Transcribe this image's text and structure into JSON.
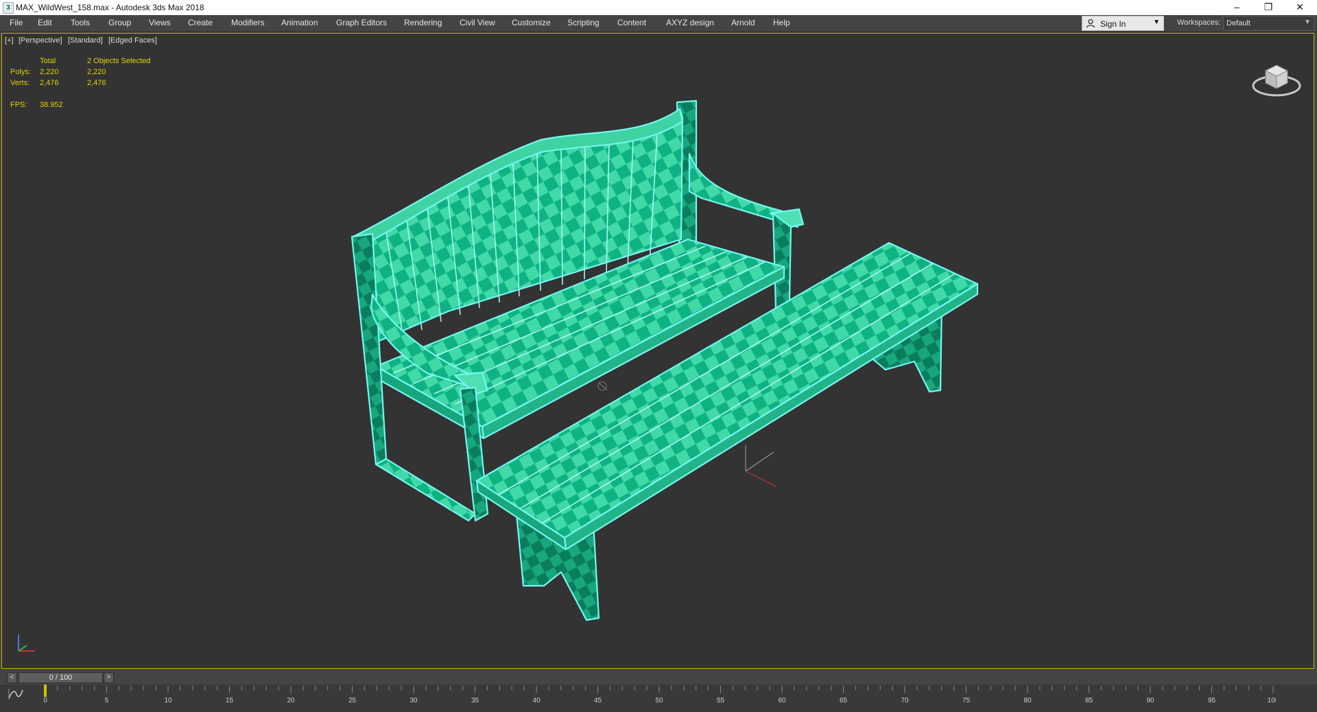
{
  "title_bar": {
    "app_icon": "3",
    "title": "MAX_WildWest_158.max - Autodesk 3ds Max 2018",
    "minimize": "–",
    "restore": "❐",
    "close": "✕"
  },
  "menu": [
    {
      "label": "File"
    },
    {
      "label": "Edit"
    },
    {
      "label": "Tools"
    },
    {
      "label": "Group"
    },
    {
      "label": "Views"
    },
    {
      "label": "Create"
    },
    {
      "label": "Modifiers"
    },
    {
      "label": "Animation"
    },
    {
      "label": "Graph Editors"
    },
    {
      "label": "Rendering"
    },
    {
      "label": "Civil View"
    },
    {
      "label": "Customize"
    },
    {
      "label": "Scripting"
    },
    {
      "label": "Content"
    },
    {
      "label": "AXYZ design"
    },
    {
      "label": "Arnold"
    },
    {
      "label": "Help"
    }
  ],
  "account": {
    "sign_in": "Sign In",
    "icon": "user-icon"
  },
  "workspaces": {
    "label": "Workspaces:",
    "value": "Default"
  },
  "viewport": {
    "labels": [
      "[+]",
      "[Perspective]",
      "[Standard]",
      "[Edged Faces]"
    ],
    "stats": {
      "header_total": "Total",
      "header_selected": "2 Objects Selected",
      "polys_label": "Polys:",
      "polys_total": "2,220",
      "polys_selected": "2,220",
      "verts_label": "Verts:",
      "verts_total": "2,476",
      "verts_selected": "2,476",
      "fps_label": "FPS:",
      "fps_value": "38.952"
    },
    "colors": {
      "mesh_fill": "#3bd6a4",
      "mesh_dark": "#0aa57a",
      "selection_outline": "#6ff3ee",
      "frame": "#c9b400"
    }
  },
  "timeline": {
    "prev": "<",
    "next": ">",
    "frame_display": "0 / 100",
    "ticks": [
      "0",
      "5",
      "10",
      "15",
      "20",
      "25",
      "30",
      "35",
      "40",
      "45",
      "50",
      "55",
      "60",
      "65",
      "70",
      "75",
      "80",
      "85",
      "90",
      "95",
      "100"
    ],
    "current_frame": 0
  }
}
